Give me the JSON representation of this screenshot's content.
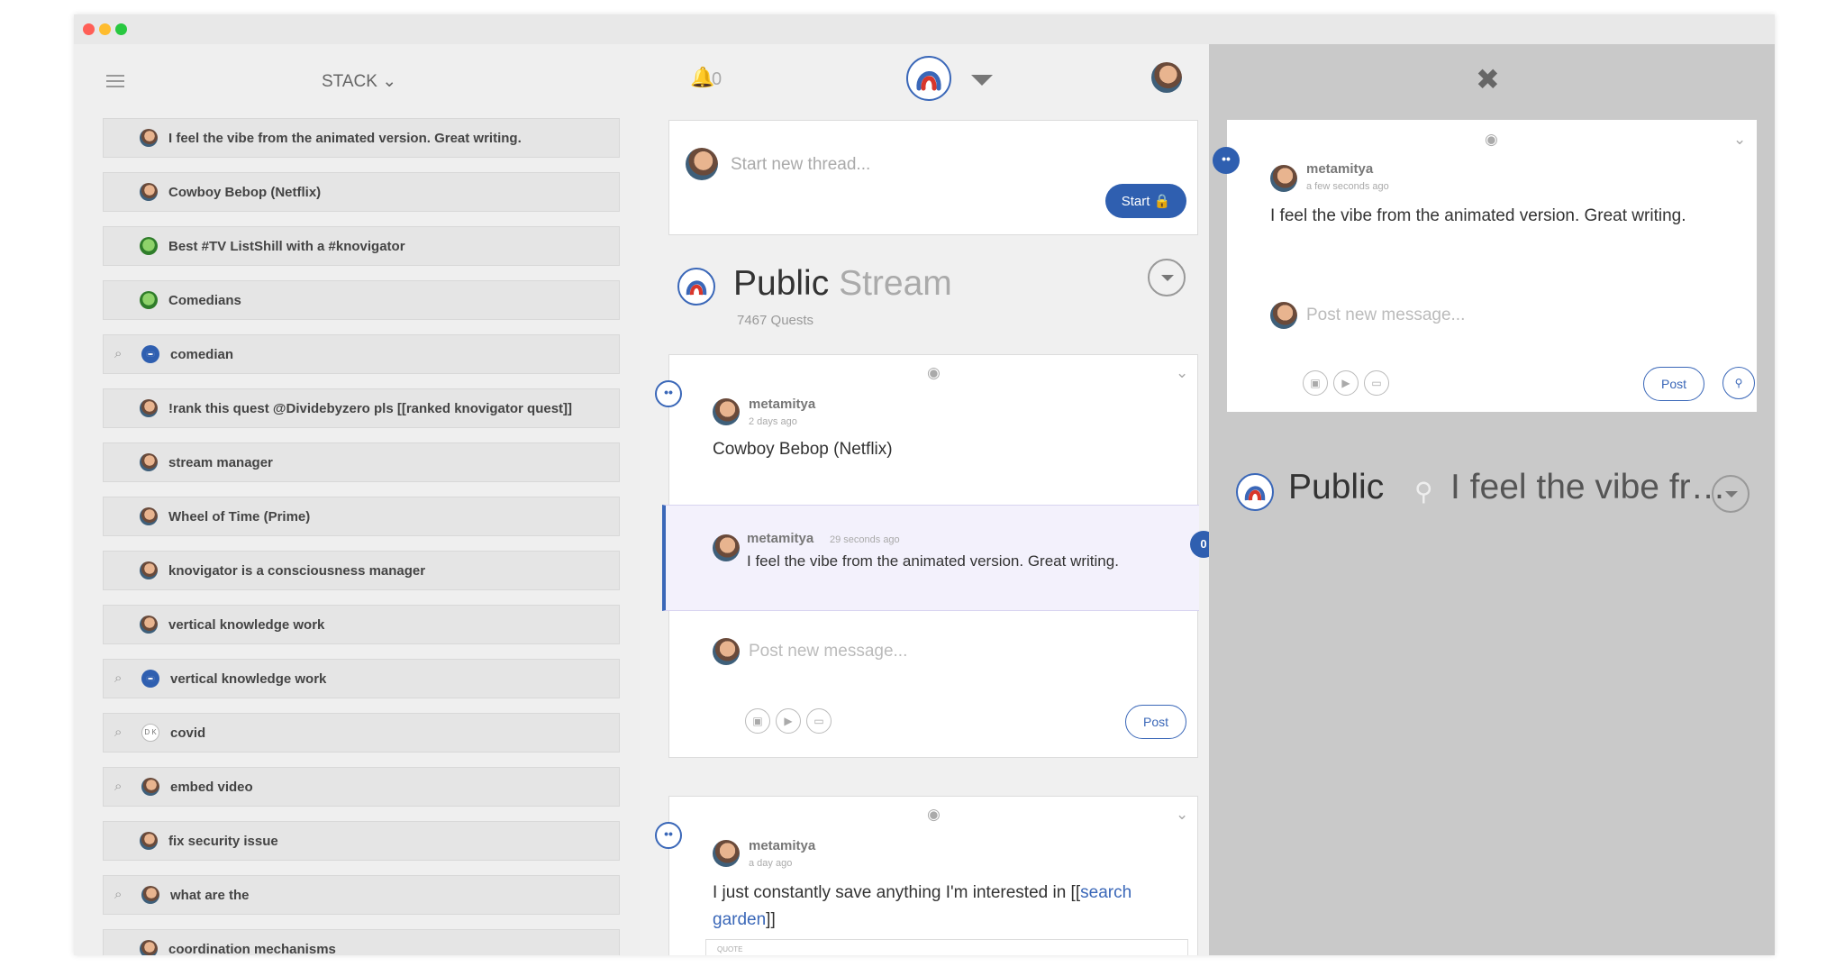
{
  "window": {
    "controls": [
      "close",
      "minimize",
      "maximize"
    ],
    "colors": {
      "close": "#ff5f57",
      "minimize": "#febc2e",
      "maximize": "#28c840",
      "accent": "#2f5fb0"
    }
  },
  "sidebar": {
    "menu_icon": "hamburger-icon",
    "stack_label": "STACK ⌄",
    "items": [
      {
        "label": "I feel the vibe from the animated version. Great writing.",
        "avatar": "person",
        "search": false
      },
      {
        "label": "Cowboy Bebop (Netflix)",
        "avatar": "person",
        "search": false
      },
      {
        "label": "Best #TV ListShill with a #knovigator",
        "avatar": "frog",
        "search": false
      },
      {
        "label": "Comedians",
        "avatar": "frog",
        "search": false
      },
      {
        "label": "comedian",
        "avatar": "eye",
        "search": true
      },
      {
        "label": "!rank this quest @Dividebyzero pls [[ranked knovigator quest]]",
        "avatar": "person",
        "search": false
      },
      {
        "label": "stream manager",
        "avatar": "person",
        "search": false
      },
      {
        "label": "Wheel of Time (Prime)",
        "avatar": "person",
        "search": false
      },
      {
        "label": "knovigator is a consciousness manager",
        "avatar": "person",
        "search": false
      },
      {
        "label": "vertical knowledge work",
        "avatar": "person",
        "search": false
      },
      {
        "label": "vertical knowledge work",
        "avatar": "eye",
        "search": true
      },
      {
        "label": "covid",
        "avatar": "dk",
        "avatar_text": "D K",
        "search": true
      },
      {
        "label": "embed video",
        "avatar": "person",
        "search": true
      },
      {
        "label": "fix security issue",
        "avatar": "person",
        "search": false
      },
      {
        "label": "what are the",
        "avatar": "person",
        "search": true
      },
      {
        "label": "coordination mechanisms",
        "avatar": "person",
        "search": false
      }
    ]
  },
  "header": {
    "bell_count": "0",
    "bell_icon": "bell-icon"
  },
  "compose": {
    "placeholder": "Start new thread...",
    "start_label": "Start 🔒"
  },
  "stream": {
    "title_main": "Public",
    "title_light": " Stream",
    "count": "7467 Quests"
  },
  "quest1": {
    "author": "metamitya",
    "time": "2 days ago",
    "text": "Cowboy Bebop (Netflix)",
    "reply": {
      "author": "metamitya",
      "time": "29 seconds ago",
      "text": "I feel the vibe from the animated version. Great writing.",
      "badge": "0"
    },
    "message_placeholder": "Post new message...",
    "post_label": "Post"
  },
  "quest2": {
    "author": "metamitya",
    "time": "a day ago",
    "text_before": "I just constantly save anything I'm interested in [[",
    "link_text": "search garden",
    "text_after": "]]",
    "quote_label": "QUOTE"
  },
  "right": {
    "close_icon": "close-icon",
    "card": {
      "author": "metamitya",
      "time": "a few seconds ago",
      "text": "I feel the vibe from the animated version. Great writing.",
      "message_placeholder": "Post new message...",
      "post_label": "Post"
    },
    "stream_title": "Public",
    "stream_query": "I feel the vibe fr…"
  }
}
